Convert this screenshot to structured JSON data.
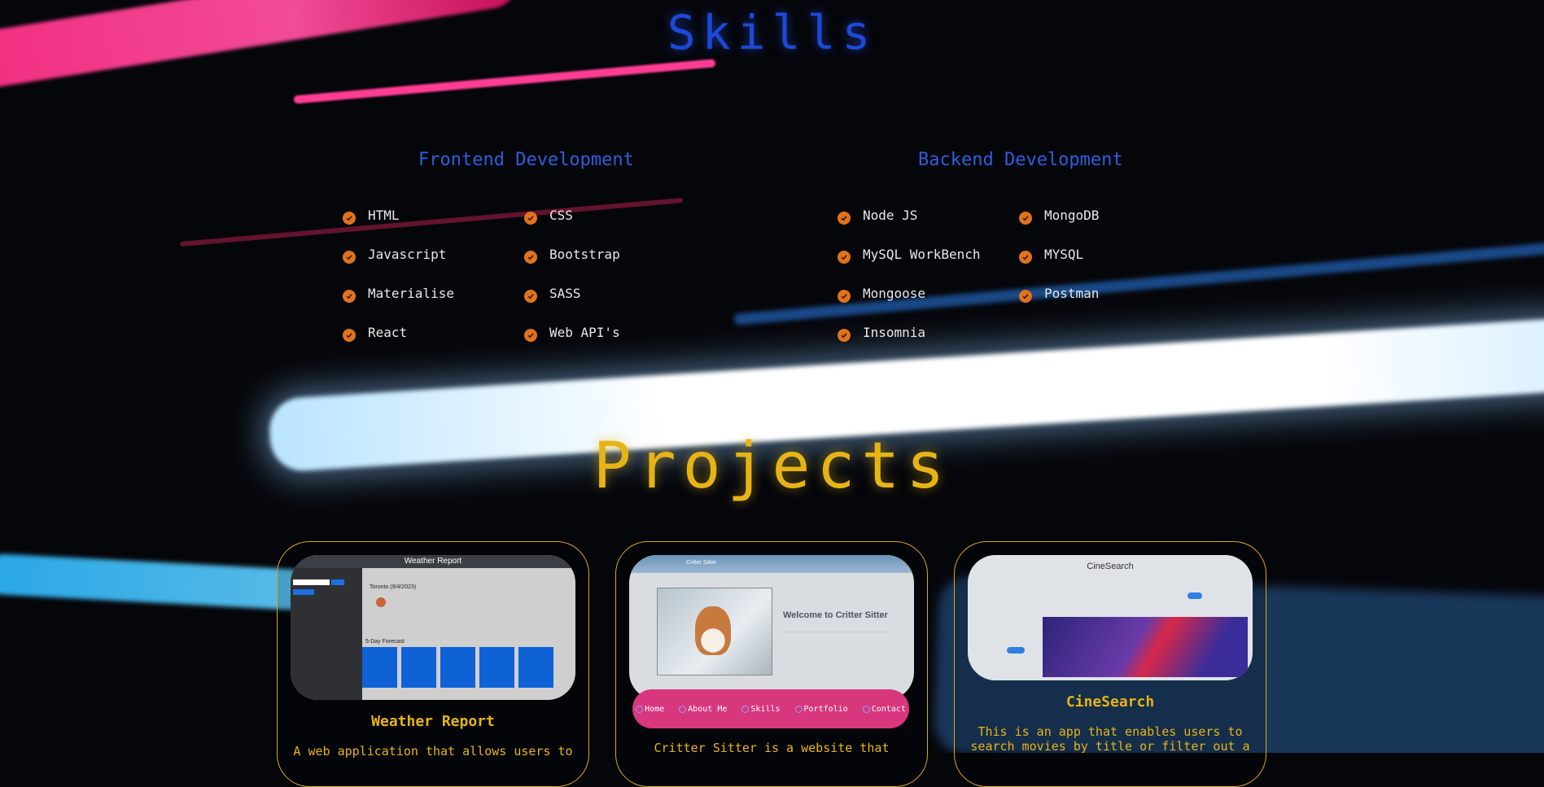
{
  "skills": {
    "title": "Skills",
    "frontend": {
      "heading": "Frontend Development",
      "items": [
        "HTML",
        "CSS",
        "Javascript",
        "Bootstrap",
        "Materialise",
        "SASS",
        "React",
        "Web API's"
      ]
    },
    "backend": {
      "heading": "Backend Development",
      "items": [
        "Node JS",
        "MongoDB",
        "MySQL WorkBench",
        "MYSQL",
        "Mongoose",
        "Postman",
        "Insomnia"
      ]
    }
  },
  "projects": {
    "title": "Projects",
    "cards": [
      {
        "title": "Weather Report",
        "description": "A web application that allows users to",
        "thumb": {
          "app_title": "Weather Report",
          "city": "Toronto (9/4/2023)",
          "forecast_label": "5-Day Forecast"
        }
      },
      {
        "title": "",
        "description": "Critter Sitter is a website that",
        "thumb": {
          "brand": "Critter Sitter",
          "heading": "Welcome to Critter Sitter"
        }
      },
      {
        "title": "CineSearch",
        "description": "This is an app that enables users to search movies by title or filter out a",
        "thumb": {
          "app_title": "CineSearch"
        }
      }
    ]
  },
  "nav": {
    "items": [
      "Home",
      "About Me",
      "Skills",
      "Portfolio",
      "Contact"
    ],
    "accent": "#d8377e"
  },
  "colors": {
    "skills_title": "#1c49d6",
    "projects_title": "#e7b416",
    "check": "#e0731b"
  }
}
